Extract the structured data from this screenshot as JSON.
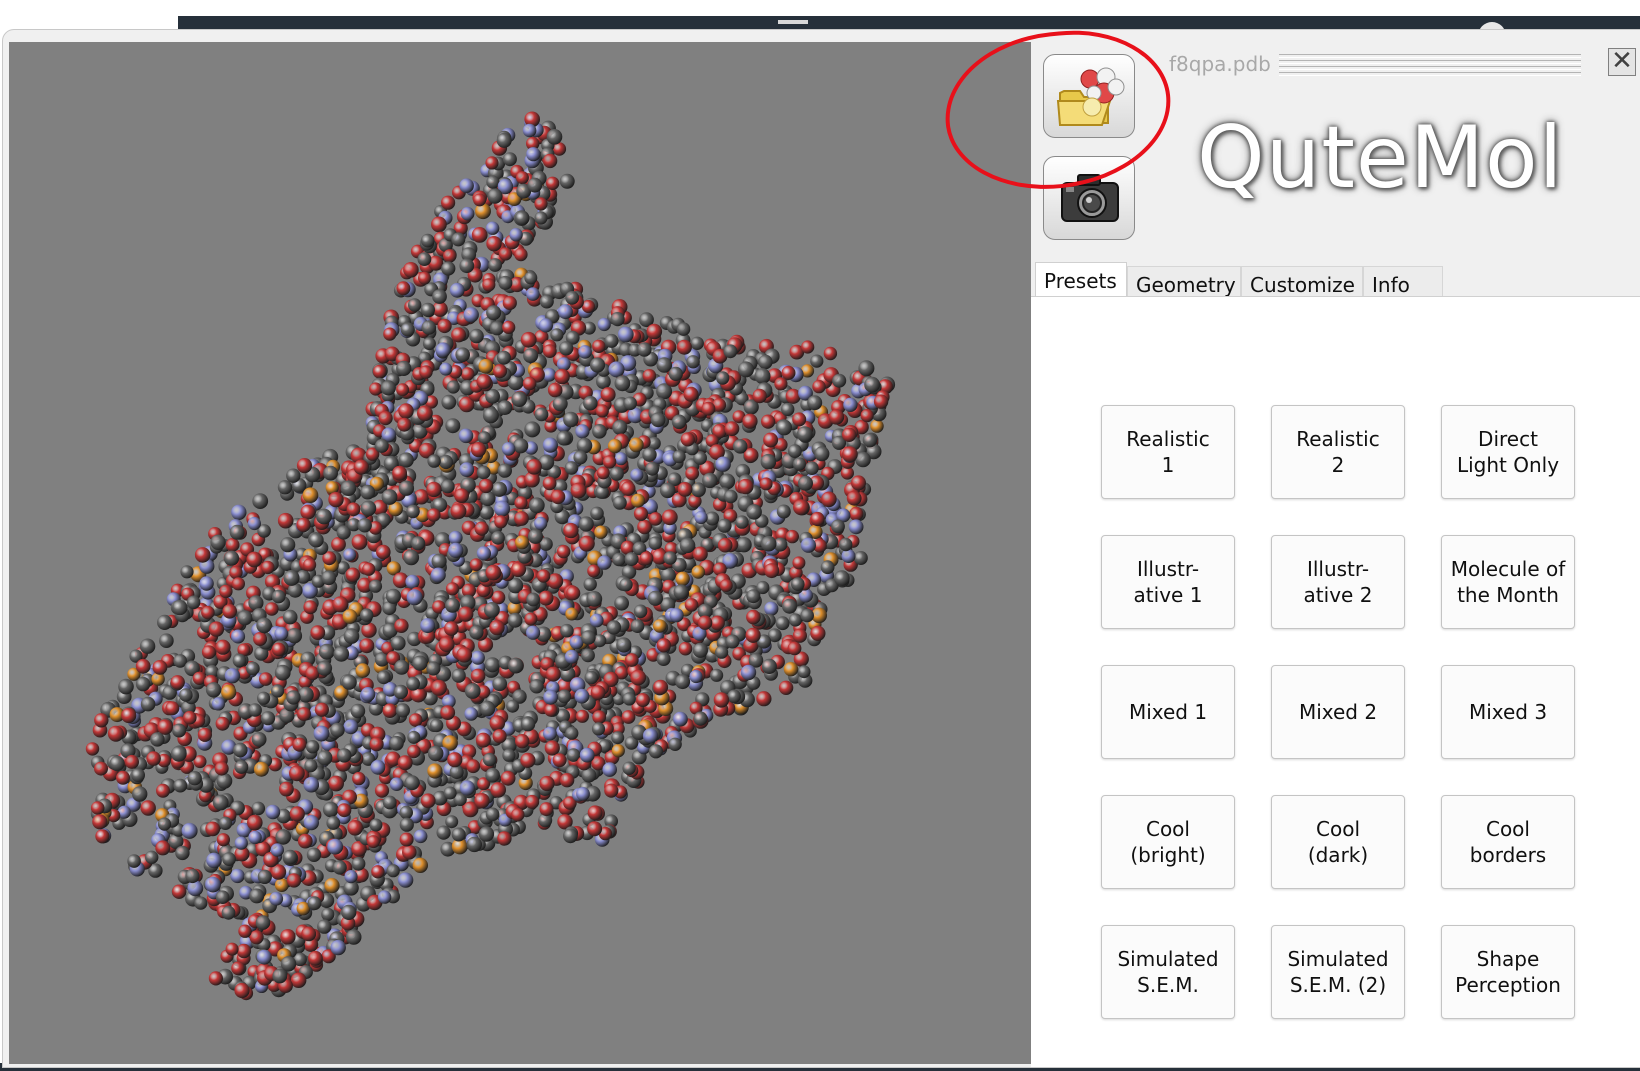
{
  "file": {
    "name": "f8qpa.pdb"
  },
  "window": {
    "close_label": "✕"
  },
  "app": {
    "logo": "QuteMol"
  },
  "toolbar": {
    "open_icon": "open-molecule-icon",
    "snapshot_icon": "camera-icon"
  },
  "tabs": [
    {
      "label": "Presets",
      "active": true
    },
    {
      "label": "Geometry",
      "active": false
    },
    {
      "label": "Customize",
      "active": false
    },
    {
      "label": "Info",
      "active": false
    }
  ],
  "presets": [
    "Realistic\n1",
    "Realistic\n2",
    "Direct\nLight Only",
    "Illustr-\native 1",
    "Illustr-\native 2",
    "Molecule of\nthe Month",
    "Mixed 1",
    "Mixed 2",
    "Mixed 3",
    "Cool\n(bright)",
    "Cool\n(dark)",
    "Cool\nborders",
    "Simulated\nS.E.M.",
    "Simulated\nS.E.M. (2)",
    "Shape\nPerception"
  ],
  "colors": {
    "viewport_bg": "#808080",
    "atom_carbon": "#666666",
    "atom_oxygen": "#c43838",
    "atom_nitrogen": "#8a8ed0",
    "atom_phosphorus": "#e0902c",
    "annotation": "#e8101a"
  }
}
